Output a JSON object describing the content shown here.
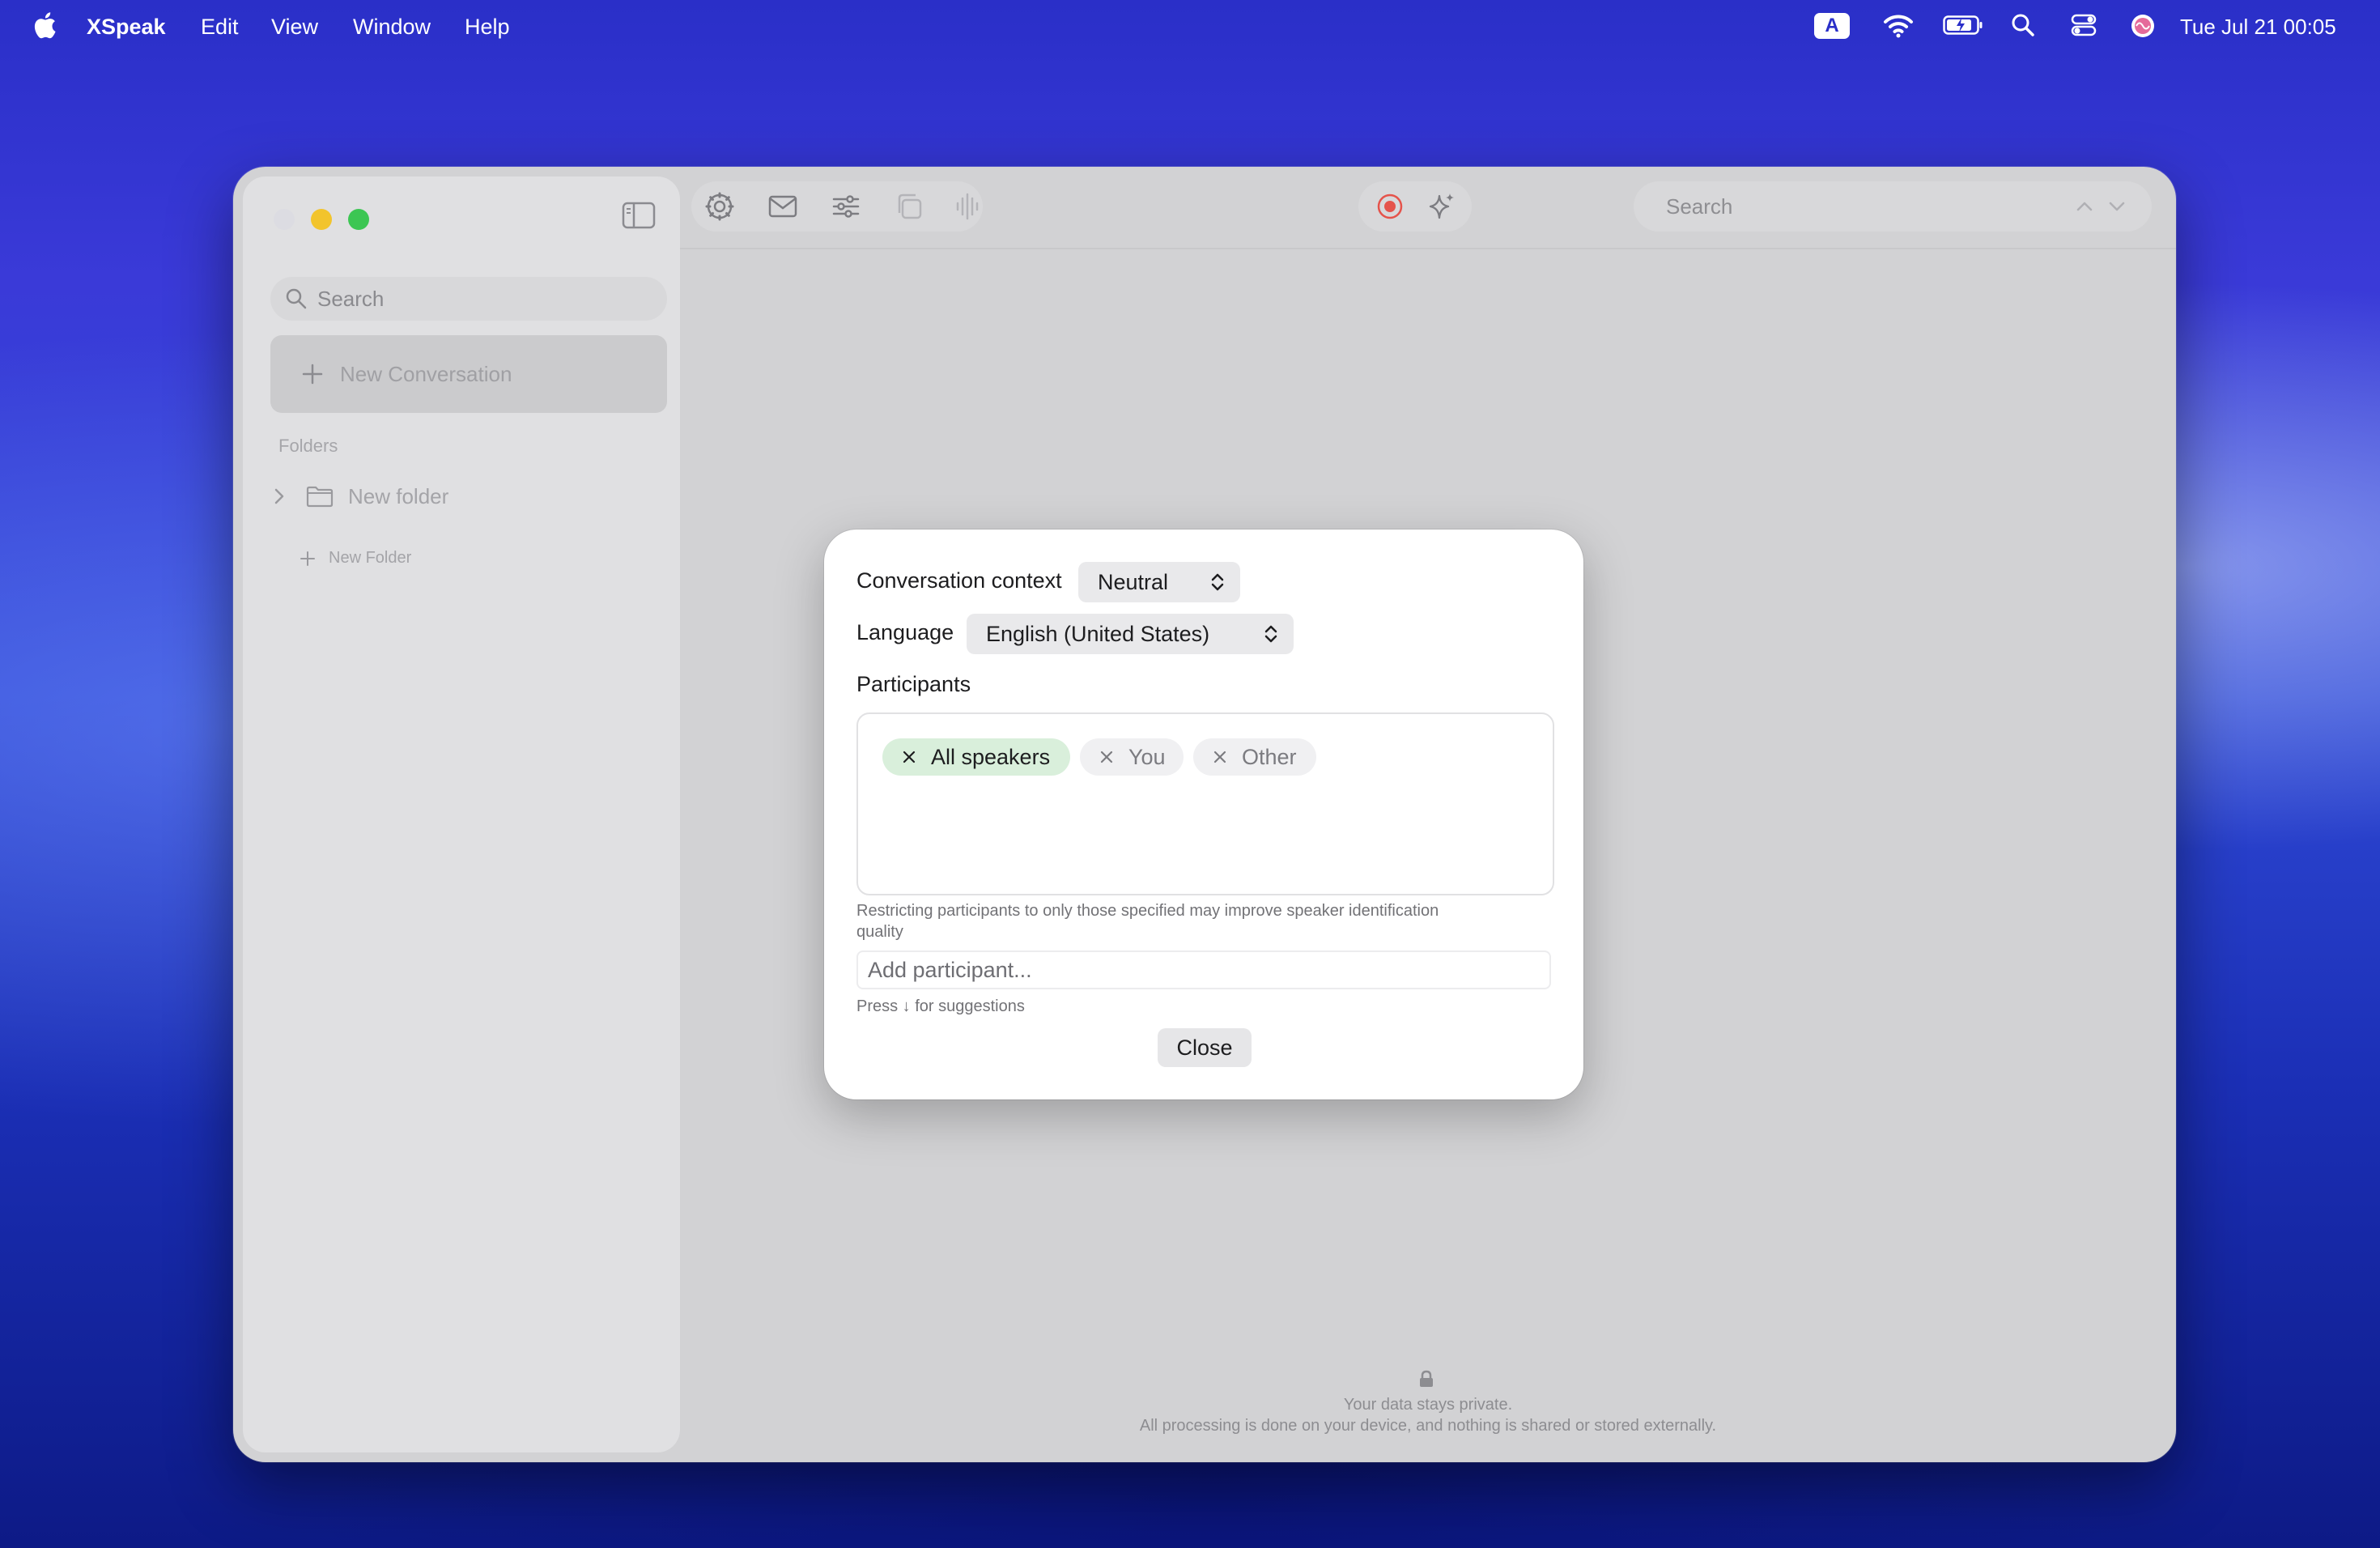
{
  "menubar": {
    "app_name": "XSpeak",
    "items": [
      "Edit",
      "View",
      "Window",
      "Help"
    ],
    "input_badge": "A",
    "clock": "Tue Jul 21  00:05"
  },
  "sidebar": {
    "search_placeholder": "Search",
    "new_conversation": "New Conversation",
    "folders_title": "Folders",
    "folders": [
      {
        "label": "New folder"
      }
    ],
    "new_folder_label": "New Folder"
  },
  "toolbar": {
    "search_placeholder": "Search"
  },
  "footer": {
    "line1": "Your data stays private.",
    "line2": "All processing is done on your device, and nothing is shared or stored externally."
  },
  "dialog": {
    "context_label": "Conversation context",
    "context_value": "Neutral",
    "language_label": "Language",
    "language_value": "English (United States)",
    "participants_title": "Participants",
    "chips": [
      {
        "label": "All speakers",
        "active": true
      },
      {
        "label": "You",
        "active": false
      },
      {
        "label": "Other",
        "active": false
      }
    ],
    "restrict_hint": "Restricting participants to only those specified may improve speaker identification quality",
    "add_placeholder": "Add participant...",
    "suggest_hint": "Press ↓ for suggestions",
    "close_label": "Close"
  },
  "colors": {
    "active_chip": "#d9efdb",
    "record_red": "#e5534b",
    "traffic_yellow": "#f2c42c",
    "traffic_green": "#3cc653"
  }
}
